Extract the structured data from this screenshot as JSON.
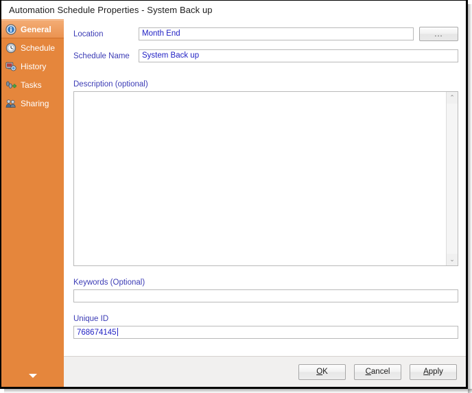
{
  "window": {
    "title": "Automation Schedule Properties - System Back up"
  },
  "sidebar": {
    "items": [
      {
        "label": "General",
        "icon": "info-circle-icon",
        "selected": true
      },
      {
        "label": "Schedule",
        "icon": "clock-icon",
        "selected": false
      },
      {
        "label": "History",
        "icon": "monitor-icon",
        "selected": false
      },
      {
        "label": "Tasks",
        "icon": "footprints-plus-icon",
        "selected": false
      },
      {
        "label": "Sharing",
        "icon": "people-icon",
        "selected": false
      }
    ],
    "expander_icon": "chevron-down-icon",
    "background_color": "#e5863c",
    "selected_color": "#f0a264"
  },
  "form": {
    "location": {
      "label": "Location",
      "value": "Month End",
      "placeholder": ""
    },
    "browse_button": {
      "label": "...",
      "name": "browse-location-button"
    },
    "schedule_name": {
      "label": "Schedule Name",
      "value": "System Back up",
      "placeholder": ""
    },
    "description": {
      "label": "Description (optional)",
      "value": "",
      "placeholder": ""
    },
    "keywords": {
      "label": "Keywords (Optional)",
      "value": "",
      "placeholder": ""
    },
    "unique_id": {
      "label": "Unique ID",
      "value": "768674145",
      "placeholder": ""
    },
    "label_color": "#3b3bb5",
    "value_color": "#2222c4"
  },
  "scrollbar": {
    "up_arrow": "⌃",
    "down_arrow": "⌄"
  },
  "footer": {
    "buttons": [
      {
        "name": "ok-button",
        "accel": "O",
        "rest": "K"
      },
      {
        "name": "cancel-button",
        "accel": "C",
        "rest": "ancel"
      },
      {
        "name": "apply-button",
        "accel": "A",
        "rest": "pply"
      }
    ]
  }
}
